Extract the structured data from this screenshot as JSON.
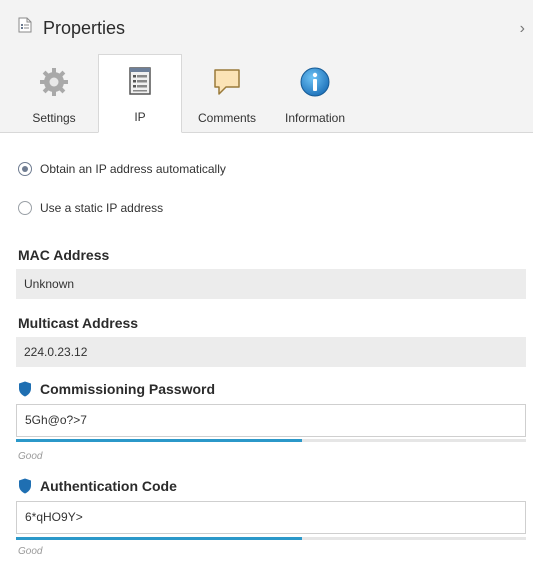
{
  "panel": {
    "title": "Properties",
    "collapse_icon": "chevron-right-icon"
  },
  "tabs": [
    {
      "label": "Settings",
      "icon": "gear-icon",
      "active": false
    },
    {
      "label": "IP",
      "icon": "list-document-icon",
      "active": true
    },
    {
      "label": "Comments",
      "icon": "speech-bubble-icon",
      "active": false
    },
    {
      "label": "Information",
      "icon": "info-icon",
      "active": false
    }
  ],
  "ip": {
    "radio_auto_label": "Obtain an IP address automatically",
    "radio_static_label": "Use a static IP address",
    "selected": "auto",
    "mac_label": "MAC Address",
    "mac_value": "Unknown",
    "multicast_label": "Multicast Address",
    "multicast_value": "224.0.23.12",
    "password_label": "Commissioning Password",
    "password_value": "5Gh@o?>7",
    "password_strength_text": "Good",
    "password_strength": 0.56,
    "auth_label": "Authentication Code",
    "auth_value": "6*qHO9Y>",
    "auth_strength_text": "Good",
    "auth_strength": 0.56
  },
  "colors": {
    "strength_bar": "#2b98c9",
    "shield": "#1f6fb2",
    "info": "#1b8fdc"
  }
}
